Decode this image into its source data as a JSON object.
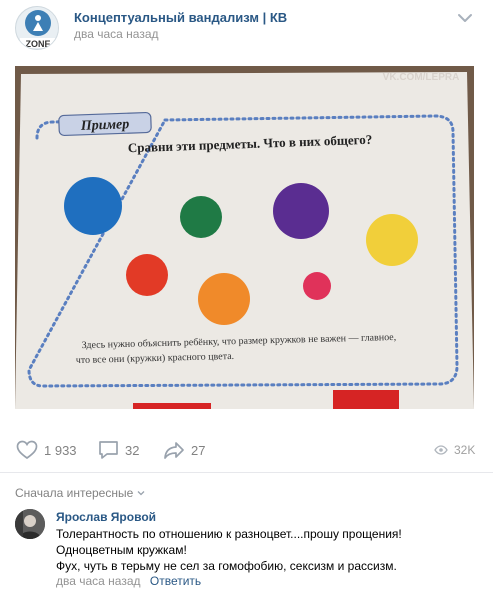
{
  "post": {
    "channel_name": "Концептуальный вандализм | КВ",
    "time": "два часа назад",
    "avatar_text": "ZONE",
    "photo": {
      "watermark": "VK.COM/LEPRA",
      "tag": "Пример",
      "question": "Сравни эти предметы. Что в них общего?",
      "caption_line1": "Здесь нужно объяснить ребёнку, что размер кружков не важен — главное,",
      "caption_line2": "что все они (кружки) красного цвета.",
      "circle_colors": [
        "#1f6fbf",
        "#1f7a45",
        "#5a2d91",
        "#f1cf3a",
        "#e23a26",
        "#f08a2a",
        "#e0325a"
      ]
    }
  },
  "actions": {
    "likes": "1 933",
    "comments": "32",
    "shares": "27",
    "views": "32K"
  },
  "comments_section": {
    "sort_label": "Сначала интересные",
    "comment": {
      "author": "Ярослав Яровой",
      "line1": "Толерантность по отношению к разноцвет....прошу прощения!",
      "line2": "Одноцветным кружкам!",
      "line3": "Фух, чуть в терьму не сел за гомофобию, сексизм и рассизм.",
      "time": "два часа назад",
      "reply": "Ответить"
    }
  },
  "colors": {
    "link": "#2a5885",
    "muted": "#828282"
  }
}
